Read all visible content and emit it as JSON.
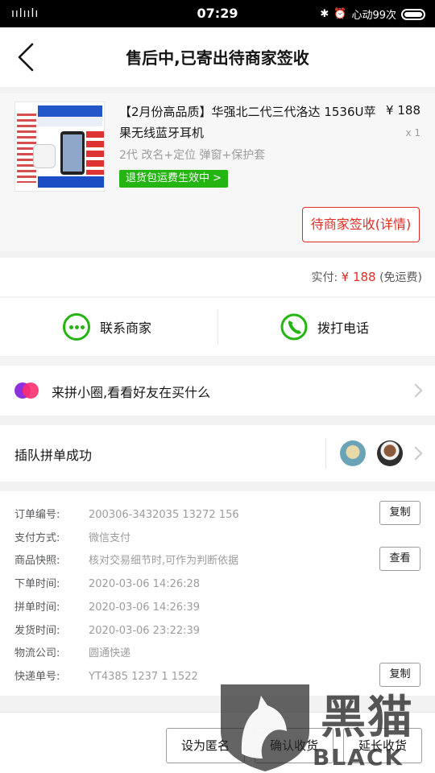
{
  "status_bar": {
    "signal": "ıılıılı",
    "time": "07:29",
    "carrier": "心动99次"
  },
  "nav": {
    "title": "售后中,已寄出待商家签收"
  },
  "product": {
    "title": "【2月份高品质】华强北二代三代洛达 1536U苹果无线蓝牙耳机",
    "price": "¥ 188",
    "quantity": "x 1",
    "spec": "2代 改名+定位 弹窗+保护套",
    "return_badge": "退货包运费生效中 >",
    "thumb_text": [
      "12月装配终极版",
      "真光感入耳检测",
      "工厂直销"
    ],
    "detail_button": "待商家签收(详情)"
  },
  "payment": {
    "label": "实付:",
    "amount": "¥ 188",
    "shipping_note": "(免运费)"
  },
  "contact": {
    "merchant_label": "联系商家",
    "call_label": "拨打电话"
  },
  "group": {
    "text": "来拼小圈,看看好友在买什么"
  },
  "insert": {
    "text": "插队拼单成功"
  },
  "order_info": {
    "rows": [
      {
        "label": "订单编号:",
        "value": "200306-3432035 13272 156"
      },
      {
        "label": "支付方式:",
        "value": "微信支付"
      },
      {
        "label": "商品快照:",
        "value": "核对交易细节时,可作为判断依据"
      },
      {
        "label": "下单时间:",
        "value": "2020-03-06 14:26:28"
      },
      {
        "label": "拼单时间:",
        "value": "2020-03-06 14:26:39"
      },
      {
        "label": "发货时间:",
        "value": "2020-03-06 23:22:39"
      },
      {
        "label": "物流公司:",
        "value": "圆通快递"
      },
      {
        "label": "快递单号:",
        "value": "YT4385 1237 1 1522"
      }
    ],
    "copy_label": "复制",
    "view_label": "查看"
  },
  "bottom_bar": {
    "anonymous": "设为匿名",
    "confirm": "确认收货",
    "extend": "延长收货"
  },
  "watermark": {
    "cn": "黑猫",
    "en": "BLACK CAT"
  },
  "colors": {
    "accent_red": "#e02e24",
    "wechat_green": "#25b513"
  }
}
